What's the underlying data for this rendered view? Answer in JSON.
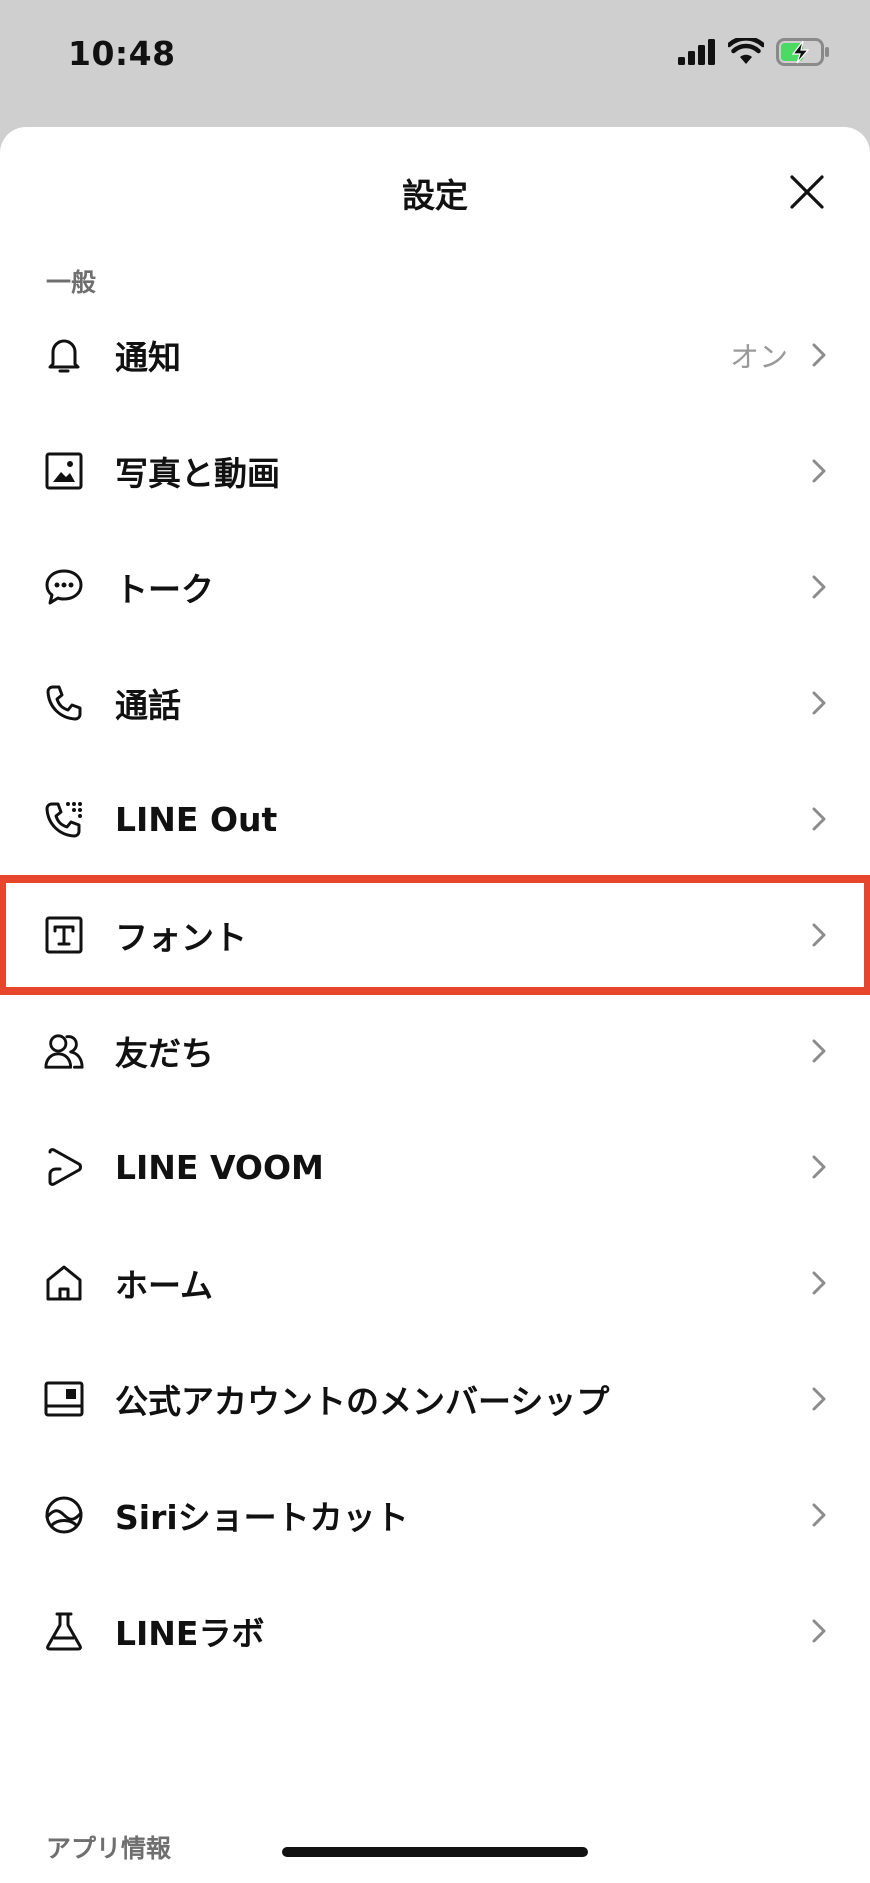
{
  "status_bar": {
    "time": "10:48",
    "signal_icon": "cellular-signal-icon",
    "wifi_icon": "wifi-icon",
    "battery_icon": "battery-charging-icon",
    "battery_color": "#4cd964"
  },
  "header": {
    "title": "設定",
    "close_icon": "close-icon"
  },
  "sections": [
    {
      "label": "一般"
    },
    {
      "label": "アプリ情報"
    }
  ],
  "items": [
    {
      "label": "通知",
      "value": "オン",
      "icon": "bell-icon"
    },
    {
      "label": "写真と動画",
      "value": "",
      "icon": "photo-icon"
    },
    {
      "label": "トーク",
      "value": "",
      "icon": "chat-bubble-icon"
    },
    {
      "label": "通話",
      "value": "",
      "icon": "phone-icon"
    },
    {
      "label": "LINE Out",
      "value": "",
      "icon": "phone-keypad-icon"
    },
    {
      "label": "フォント",
      "value": "",
      "icon": "font-icon"
    },
    {
      "label": "友だち",
      "value": "",
      "icon": "friends-icon"
    },
    {
      "label": "LINE VOOM",
      "value": "",
      "icon": "voom-play-icon"
    },
    {
      "label": "ホーム",
      "value": "",
      "icon": "home-icon"
    },
    {
      "label": "公式アカウントのメンバーシップ",
      "value": "",
      "icon": "membership-icon"
    },
    {
      "label": "Siriショートカット",
      "value": "",
      "icon": "siri-icon"
    },
    {
      "label": "LINEラボ",
      "value": "",
      "icon": "flask-icon"
    }
  ],
  "highlight_color": "#e8452e"
}
